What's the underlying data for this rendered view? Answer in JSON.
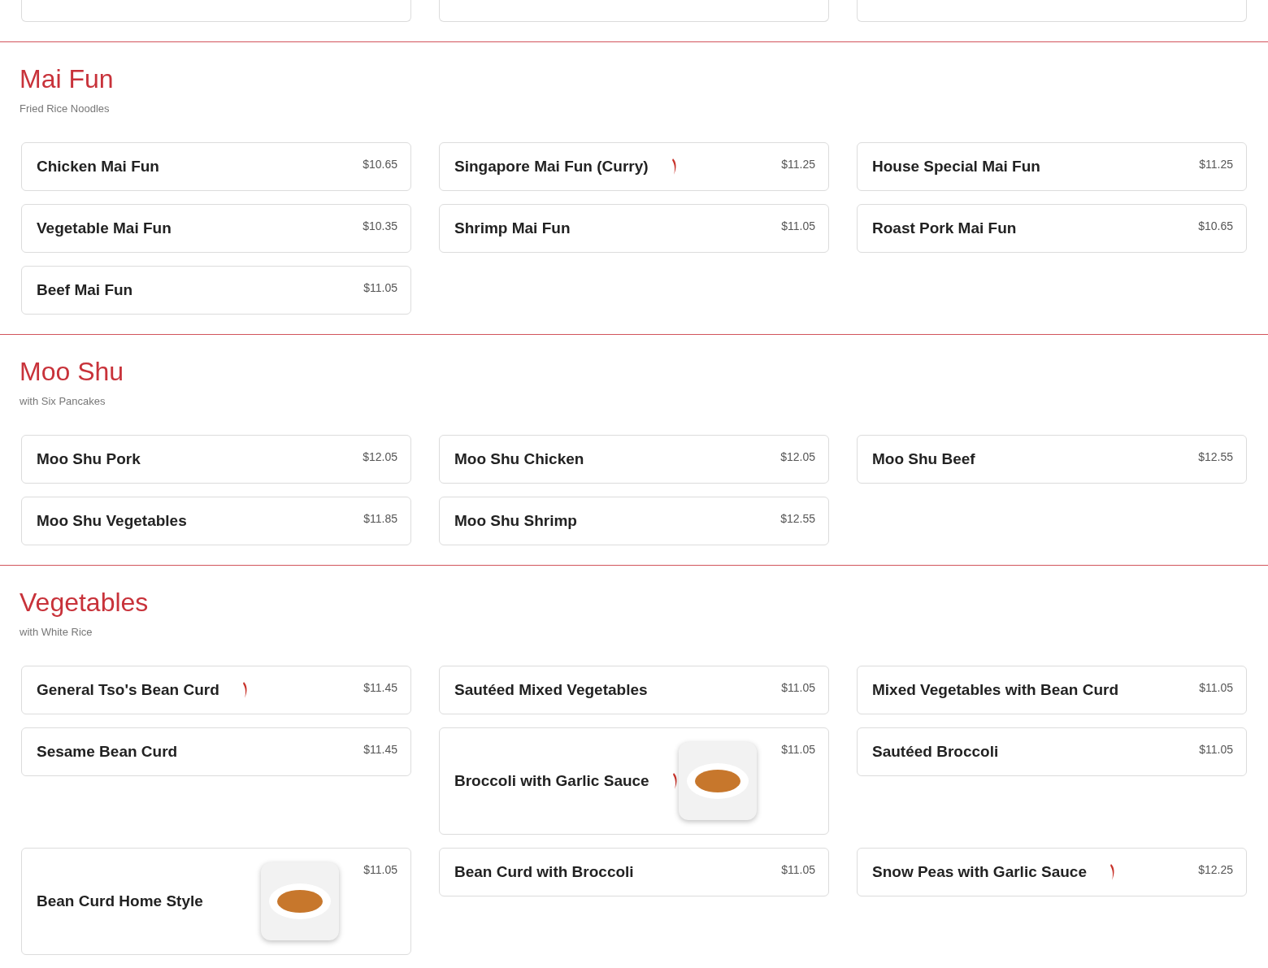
{
  "sections": [
    {
      "title": "Mai Fun",
      "subtitle": "Fried Rice Noodles",
      "items": [
        {
          "name": "Chicken Mai Fun",
          "price": "$10.65",
          "spicy": false,
          "photo": false
        },
        {
          "name": "Singapore Mai Fun (Curry)",
          "price": "$11.25",
          "spicy": true,
          "photo": false
        },
        {
          "name": "House Special Mai Fun",
          "price": "$11.25",
          "spicy": false,
          "photo": false
        },
        {
          "name": "Vegetable Mai Fun",
          "price": "$10.35",
          "spicy": false,
          "photo": false
        },
        {
          "name": "Shrimp Mai Fun",
          "price": "$11.05",
          "spicy": false,
          "photo": false
        },
        {
          "name": "Roast Pork Mai Fun",
          "price": "$10.65",
          "spicy": false,
          "photo": false
        },
        {
          "name": "Beef Mai Fun",
          "price": "$11.05",
          "spicy": false,
          "photo": false
        }
      ]
    },
    {
      "title": "Moo Shu",
      "subtitle": "with Six Pancakes",
      "items": [
        {
          "name": "Moo Shu Pork",
          "price": "$12.05",
          "spicy": false,
          "photo": false
        },
        {
          "name": "Moo Shu Chicken",
          "price": "$12.05",
          "spicy": false,
          "photo": false
        },
        {
          "name": "Moo Shu Beef",
          "price": "$12.55",
          "spicy": false,
          "photo": false
        },
        {
          "name": "Moo Shu Vegetables",
          "price": "$11.85",
          "spicy": false,
          "photo": false
        },
        {
          "name": "Moo Shu Shrimp",
          "price": "$12.55",
          "spicy": false,
          "photo": false
        }
      ]
    },
    {
      "title": "Vegetables",
      "subtitle": "with White Rice",
      "items": [
        {
          "name": "General Tso's Bean Curd",
          "price": "$11.45",
          "spicy": true,
          "photo": false
        },
        {
          "name": "Sautéed Mixed Vegetables",
          "price": "$11.05",
          "spicy": false,
          "photo": false
        },
        {
          "name": "Mixed Vegetables with Bean Curd",
          "price": "$11.05",
          "spicy": false,
          "photo": false
        },
        {
          "name": "Sesame Bean Curd",
          "price": "$11.45",
          "spicy": false,
          "photo": false
        },
        {
          "name": "Broccoli with Garlic Sauce",
          "price": "$11.05",
          "spicy": true,
          "photo": true
        },
        {
          "name": "Sautéed Broccoli",
          "price": "$11.05",
          "spicy": false,
          "photo": false
        },
        {
          "name": "Bean Curd Home Style",
          "price": "$11.05",
          "spicy": false,
          "photo": true
        },
        {
          "name": "Bean Curd with Broccoli",
          "price": "$11.05",
          "spicy": false,
          "photo": false
        },
        {
          "name": "Snow Peas with Garlic Sauce",
          "price": "$12.25",
          "spicy": true,
          "photo": false
        }
      ]
    }
  ]
}
